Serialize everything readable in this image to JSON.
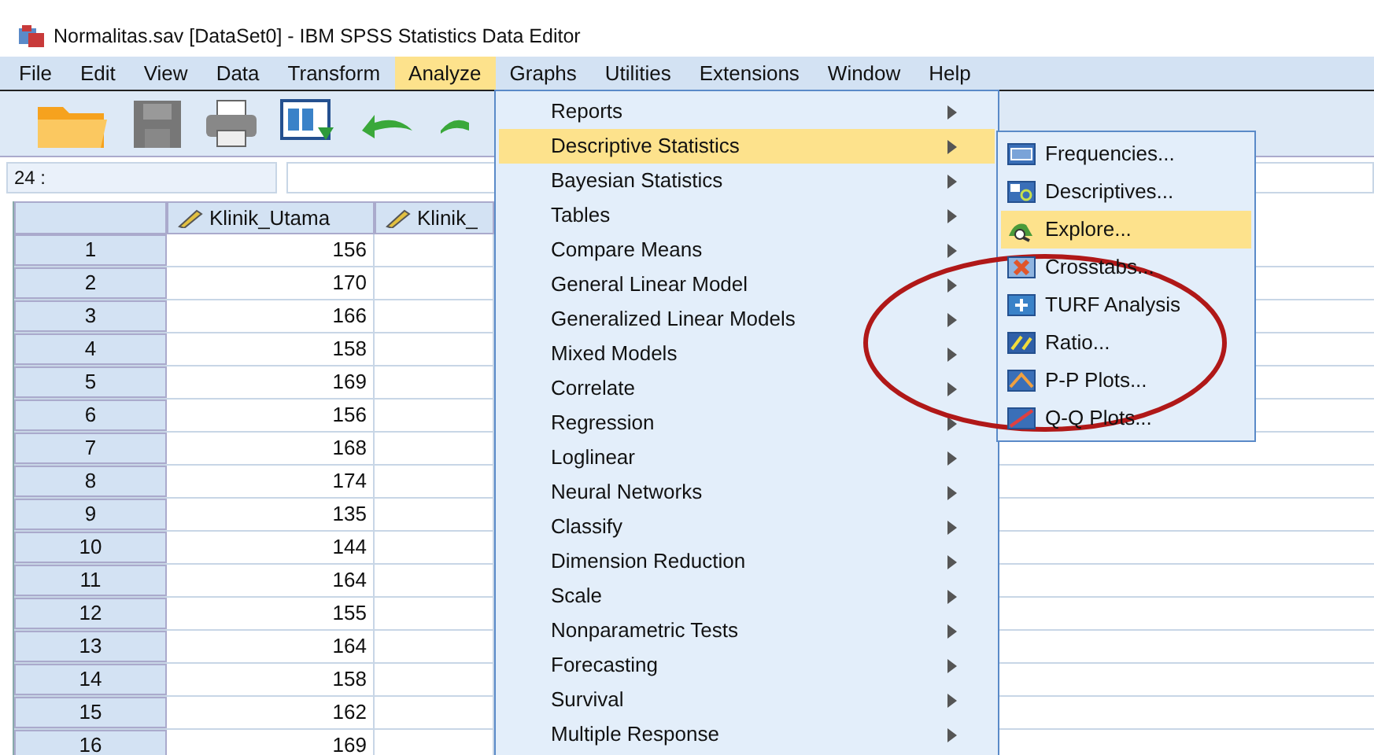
{
  "window": {
    "title": "Normalitas.sav [DataSet0] - IBM SPSS Statistics Data Editor"
  },
  "menu_bar": [
    {
      "label": "File",
      "selected": false
    },
    {
      "label": "Edit",
      "selected": false
    },
    {
      "label": "View",
      "selected": false
    },
    {
      "label": "Data",
      "selected": false
    },
    {
      "label": "Transform",
      "selected": false
    },
    {
      "label": "Analyze",
      "selected": true
    },
    {
      "label": "Graphs",
      "selected": false
    },
    {
      "label": "Utilities",
      "selected": false
    },
    {
      "label": "Extensions",
      "selected": false
    },
    {
      "label": "Window",
      "selected": false
    },
    {
      "label": "Help",
      "selected": false
    }
  ],
  "cell_ref": "24 :",
  "table": {
    "columns": [
      "Klinik_Utama",
      "Klinik_"
    ],
    "rows": [
      {
        "number": "1",
        "value": "156"
      },
      {
        "number": "2",
        "value": "170"
      },
      {
        "number": "3",
        "value": "166"
      },
      {
        "number": "4",
        "value": "158"
      },
      {
        "number": "5",
        "value": "169"
      },
      {
        "number": "6",
        "value": "156"
      },
      {
        "number": "7",
        "value": "168"
      },
      {
        "number": "8",
        "value": "174"
      },
      {
        "number": "9",
        "value": "135"
      },
      {
        "number": "10",
        "value": "144"
      },
      {
        "number": "11",
        "value": "164"
      },
      {
        "number": "12",
        "value": "155"
      },
      {
        "number": "13",
        "value": "164"
      },
      {
        "number": "14",
        "value": "158"
      },
      {
        "number": "15",
        "value": "162"
      },
      {
        "number": "16",
        "value": "169"
      }
    ]
  },
  "analyze_menu": [
    {
      "label": "Reports",
      "selected": false
    },
    {
      "label": "Descriptive Statistics",
      "selected": true
    },
    {
      "label": "Bayesian Statistics",
      "selected": false
    },
    {
      "label": "Tables",
      "selected": false
    },
    {
      "label": "Compare Means",
      "selected": false
    },
    {
      "label": "General Linear Model",
      "selected": false
    },
    {
      "label": "Generalized Linear Models",
      "selected": false
    },
    {
      "label": "Mixed Models",
      "selected": false
    },
    {
      "label": "Correlate",
      "selected": false
    },
    {
      "label": "Regression",
      "selected": false
    },
    {
      "label": "Loglinear",
      "selected": false
    },
    {
      "label": "Neural Networks",
      "selected": false
    },
    {
      "label": "Classify",
      "selected": false
    },
    {
      "label": "Dimension Reduction",
      "selected": false
    },
    {
      "label": "Scale",
      "selected": false
    },
    {
      "label": "Nonparametric Tests",
      "selected": false
    },
    {
      "label": "Forecasting",
      "selected": false
    },
    {
      "label": "Survival",
      "selected": false
    },
    {
      "label": "Multiple Response",
      "selected": false
    }
  ],
  "descriptive_submenu": [
    {
      "label": "Frequencies...",
      "kind": "freq",
      "selected": false
    },
    {
      "label": "Descriptives...",
      "kind": "desc",
      "selected": false
    },
    {
      "label": "Explore...",
      "kind": "explore",
      "selected": true
    },
    {
      "label": "Crosstabs...",
      "kind": "cross",
      "selected": false
    },
    {
      "label": "TURF Analysis",
      "kind": "turf",
      "selected": false
    },
    {
      "label": "Ratio...",
      "kind": "ratio",
      "selected": false
    },
    {
      "label": "P-P Plots...",
      "kind": "pp",
      "selected": false
    },
    {
      "label": "Q-Q Plots...",
      "kind": "qq",
      "selected": false
    }
  ]
}
